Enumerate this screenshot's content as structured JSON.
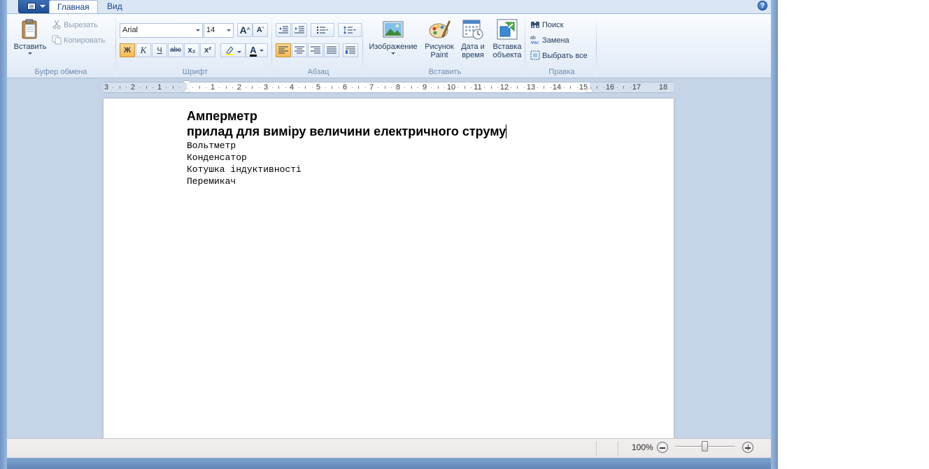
{
  "tabs": [
    {
      "label": "Главная",
      "active": true
    },
    {
      "label": "Вид",
      "active": false
    }
  ],
  "clipboard": {
    "paste_label": "Вставить",
    "cut_label": "Вырезать",
    "copy_label": "Копировать",
    "group_label": "Буфер обмена"
  },
  "font": {
    "family_value": "Arial",
    "size_value": "14",
    "bold_label": "Ж",
    "italic_label": "К",
    "underline_label": "Ч",
    "strike_label": "abc",
    "subscript_label": "x₂",
    "superscript_label": "x²",
    "grow_label": "A",
    "shrink_label": "A",
    "color_label": "A",
    "group_label": "Шрифт",
    "highlight_color": "#ffff00",
    "text_color": "#000000"
  },
  "paragraph": {
    "group_label": "Абзац"
  },
  "insert": {
    "image_label": "Изображение",
    "paint_label_1": "Рисунок",
    "paint_label_2": "Paint",
    "datetime_label_1": "Дата и",
    "datetime_label_2": "время",
    "object_label_1": "Вставка",
    "object_label_2": "объекта",
    "group_label": "Вставить"
  },
  "editing": {
    "find_label": "Поиск",
    "replace_label": "Замена",
    "select_all_label": "Выбрать все",
    "group_label": "Правка"
  },
  "ruler": {
    "labels": [
      "3",
      "2",
      "1",
      "1",
      "2",
      "3",
      "4",
      "5",
      "6",
      "7",
      "8",
      "9",
      "10",
      "11",
      "12",
      "13",
      "14",
      "15",
      "16",
      "17",
      "18"
    ]
  },
  "document": {
    "heading_line_1": "Амперметр",
    "heading_line_2": "прилад для виміру величини електричного струму",
    "lines": [
      "Вольтметр",
      "Конденсатор",
      "Котушка індуктивності",
      "Перемикач"
    ]
  },
  "status": {
    "zoom_label": "100%",
    "zoom_level_percent": 100
  },
  "colors": {
    "ribbon_bg": "#eaf1fa",
    "workspace_bg": "#c5d4e6",
    "accent_button": "#f8b94f",
    "title_frame": "#3a6aa6"
  }
}
